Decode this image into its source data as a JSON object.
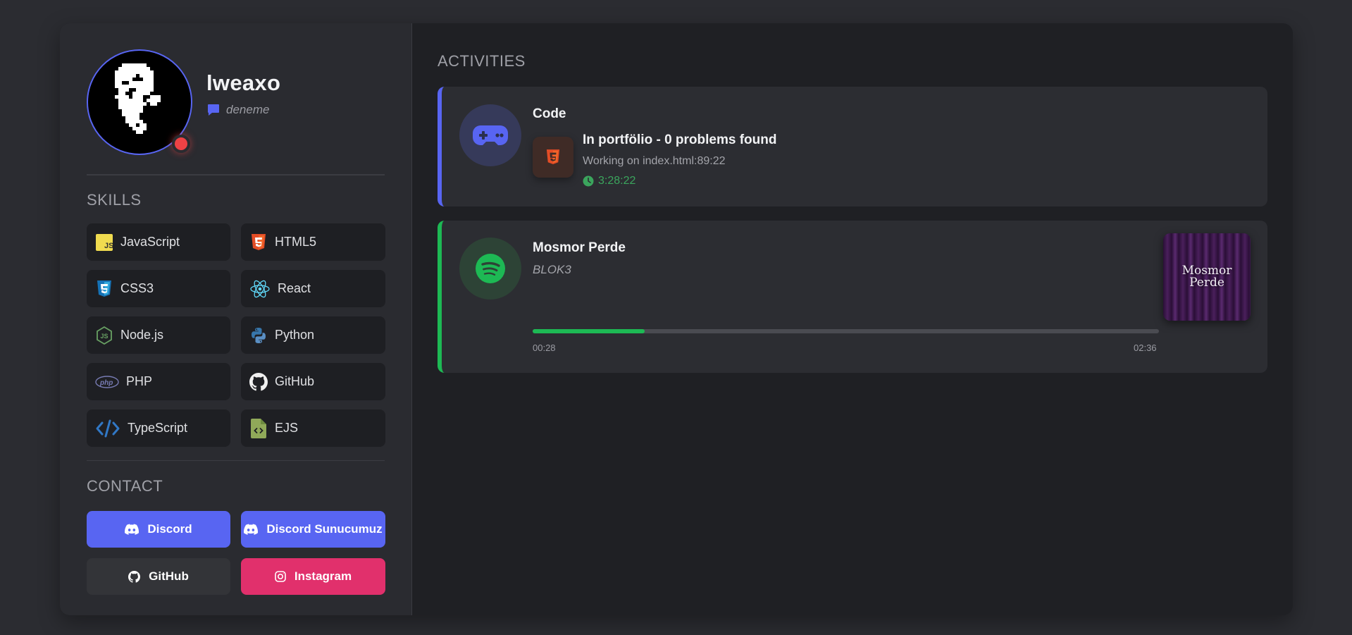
{
  "profile": {
    "username": "lweaxo",
    "custom_status": "deneme",
    "status": "dnd"
  },
  "skills_title": "SKILLS",
  "skills": [
    {
      "label": "JavaScript",
      "icon": "javascript-icon"
    },
    {
      "label": "HTML5",
      "icon": "html5-icon"
    },
    {
      "label": "CSS3",
      "icon": "css3-icon"
    },
    {
      "label": "React",
      "icon": "react-icon"
    },
    {
      "label": "Node.js",
      "icon": "nodejs-icon"
    },
    {
      "label": "Python",
      "icon": "python-icon"
    },
    {
      "label": "PHP",
      "icon": "php-icon"
    },
    {
      "label": "GitHub",
      "icon": "github-icon"
    },
    {
      "label": "TypeScript",
      "icon": "code-icon"
    },
    {
      "label": "EJS",
      "icon": "file-code-icon"
    }
  ],
  "contact_title": "CONTACT",
  "contacts": [
    {
      "label": "Discord",
      "icon": "discord-icon",
      "color": "#5865f2"
    },
    {
      "label": "Discord Sunucumuz",
      "icon": "discord-icon",
      "color": "#5865f2"
    },
    {
      "label": "GitHub",
      "icon": "github-icon",
      "color": "#333438"
    },
    {
      "label": "Instagram",
      "icon": "instagram-icon",
      "color": "#e1306c"
    }
  ],
  "activities_title": "ACTIVITIES",
  "activity_code": {
    "name": "Code",
    "details": "In portfölio - 0 problems found",
    "state": "Working on index.html:89:22",
    "elapsed": "3:28:22"
  },
  "activity_spotify": {
    "song": "Mosmor Perde",
    "artist": "BLOK3",
    "album_art_text_1": "Mosmor",
    "album_art_text_2": "Perde",
    "current_time": "00:28",
    "total_time": "02:36",
    "progress": 0.179
  },
  "colors": {
    "discord": "#5865f2",
    "spotify": "#1db954",
    "dnd": "#ed4245",
    "instagram": "#e1306c"
  }
}
